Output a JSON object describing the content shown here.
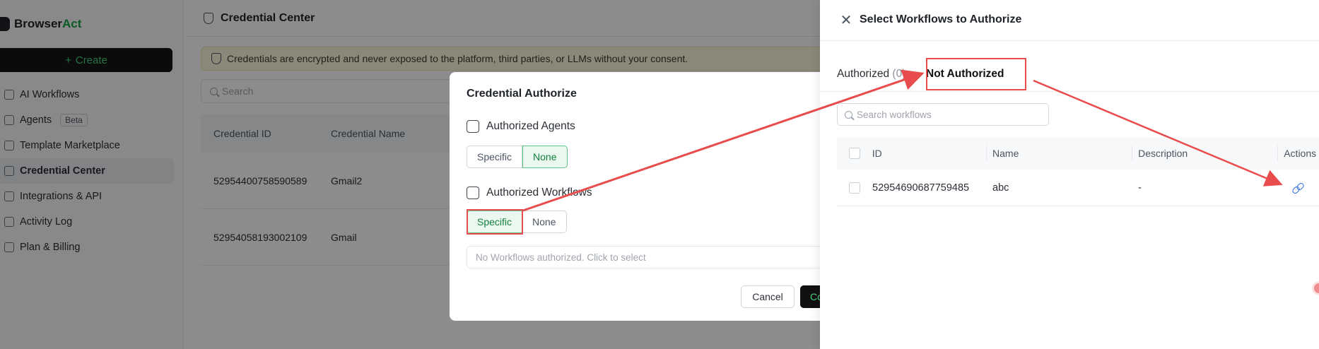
{
  "sidebar": {
    "brand_part1": "Browser",
    "brand_part2": "Act",
    "create_label": "Create",
    "items": [
      {
        "label": "AI Workflows"
      },
      {
        "label": "Agents",
        "badge": "Beta"
      },
      {
        "label": "Template Marketplace"
      },
      {
        "label": "Credential Center"
      },
      {
        "label": "Integrations & API"
      },
      {
        "label": "Activity Log"
      },
      {
        "label": "Plan & Billing"
      }
    ]
  },
  "main": {
    "title": "Credential Center",
    "notice": "Credentials are encrypted and never exposed to the platform, third parties, or LLMs without your consent.",
    "search_placeholder": "Search",
    "columns": [
      "Credential ID",
      "Credential Name"
    ],
    "rows": [
      {
        "id": "52954400758590589",
        "name": "Gmail2"
      },
      {
        "id": "52954058193002109",
        "name": "Gmail"
      }
    ]
  },
  "modal": {
    "title": "Credential Authorize",
    "agents_title": "Authorized Agents",
    "workflows_title": "Authorized Workflows",
    "specific_label": "Specific",
    "none_label": "None",
    "workflows_placeholder": "No Workflows authorized. Click to select",
    "cancel_label": "Cancel",
    "confirm_label": "Co"
  },
  "drawer": {
    "title": "Select Workflows to Authorize",
    "tab_authorized": "Authorized",
    "tab_authorized_count": "(0)",
    "tab_not_authorized": "Not Authorized",
    "search_placeholder": "Search workflows",
    "columns": {
      "id": "ID",
      "name": "Name",
      "description": "Description",
      "actions": "Actions"
    },
    "rows": [
      {
        "id": "52954690687759485",
        "name": "abc",
        "description": "-"
      }
    ]
  },
  "colors": {
    "accent_green": "#16a34a",
    "highlight_red": "#e84c4c",
    "link_blue": "#2f6fe0"
  }
}
